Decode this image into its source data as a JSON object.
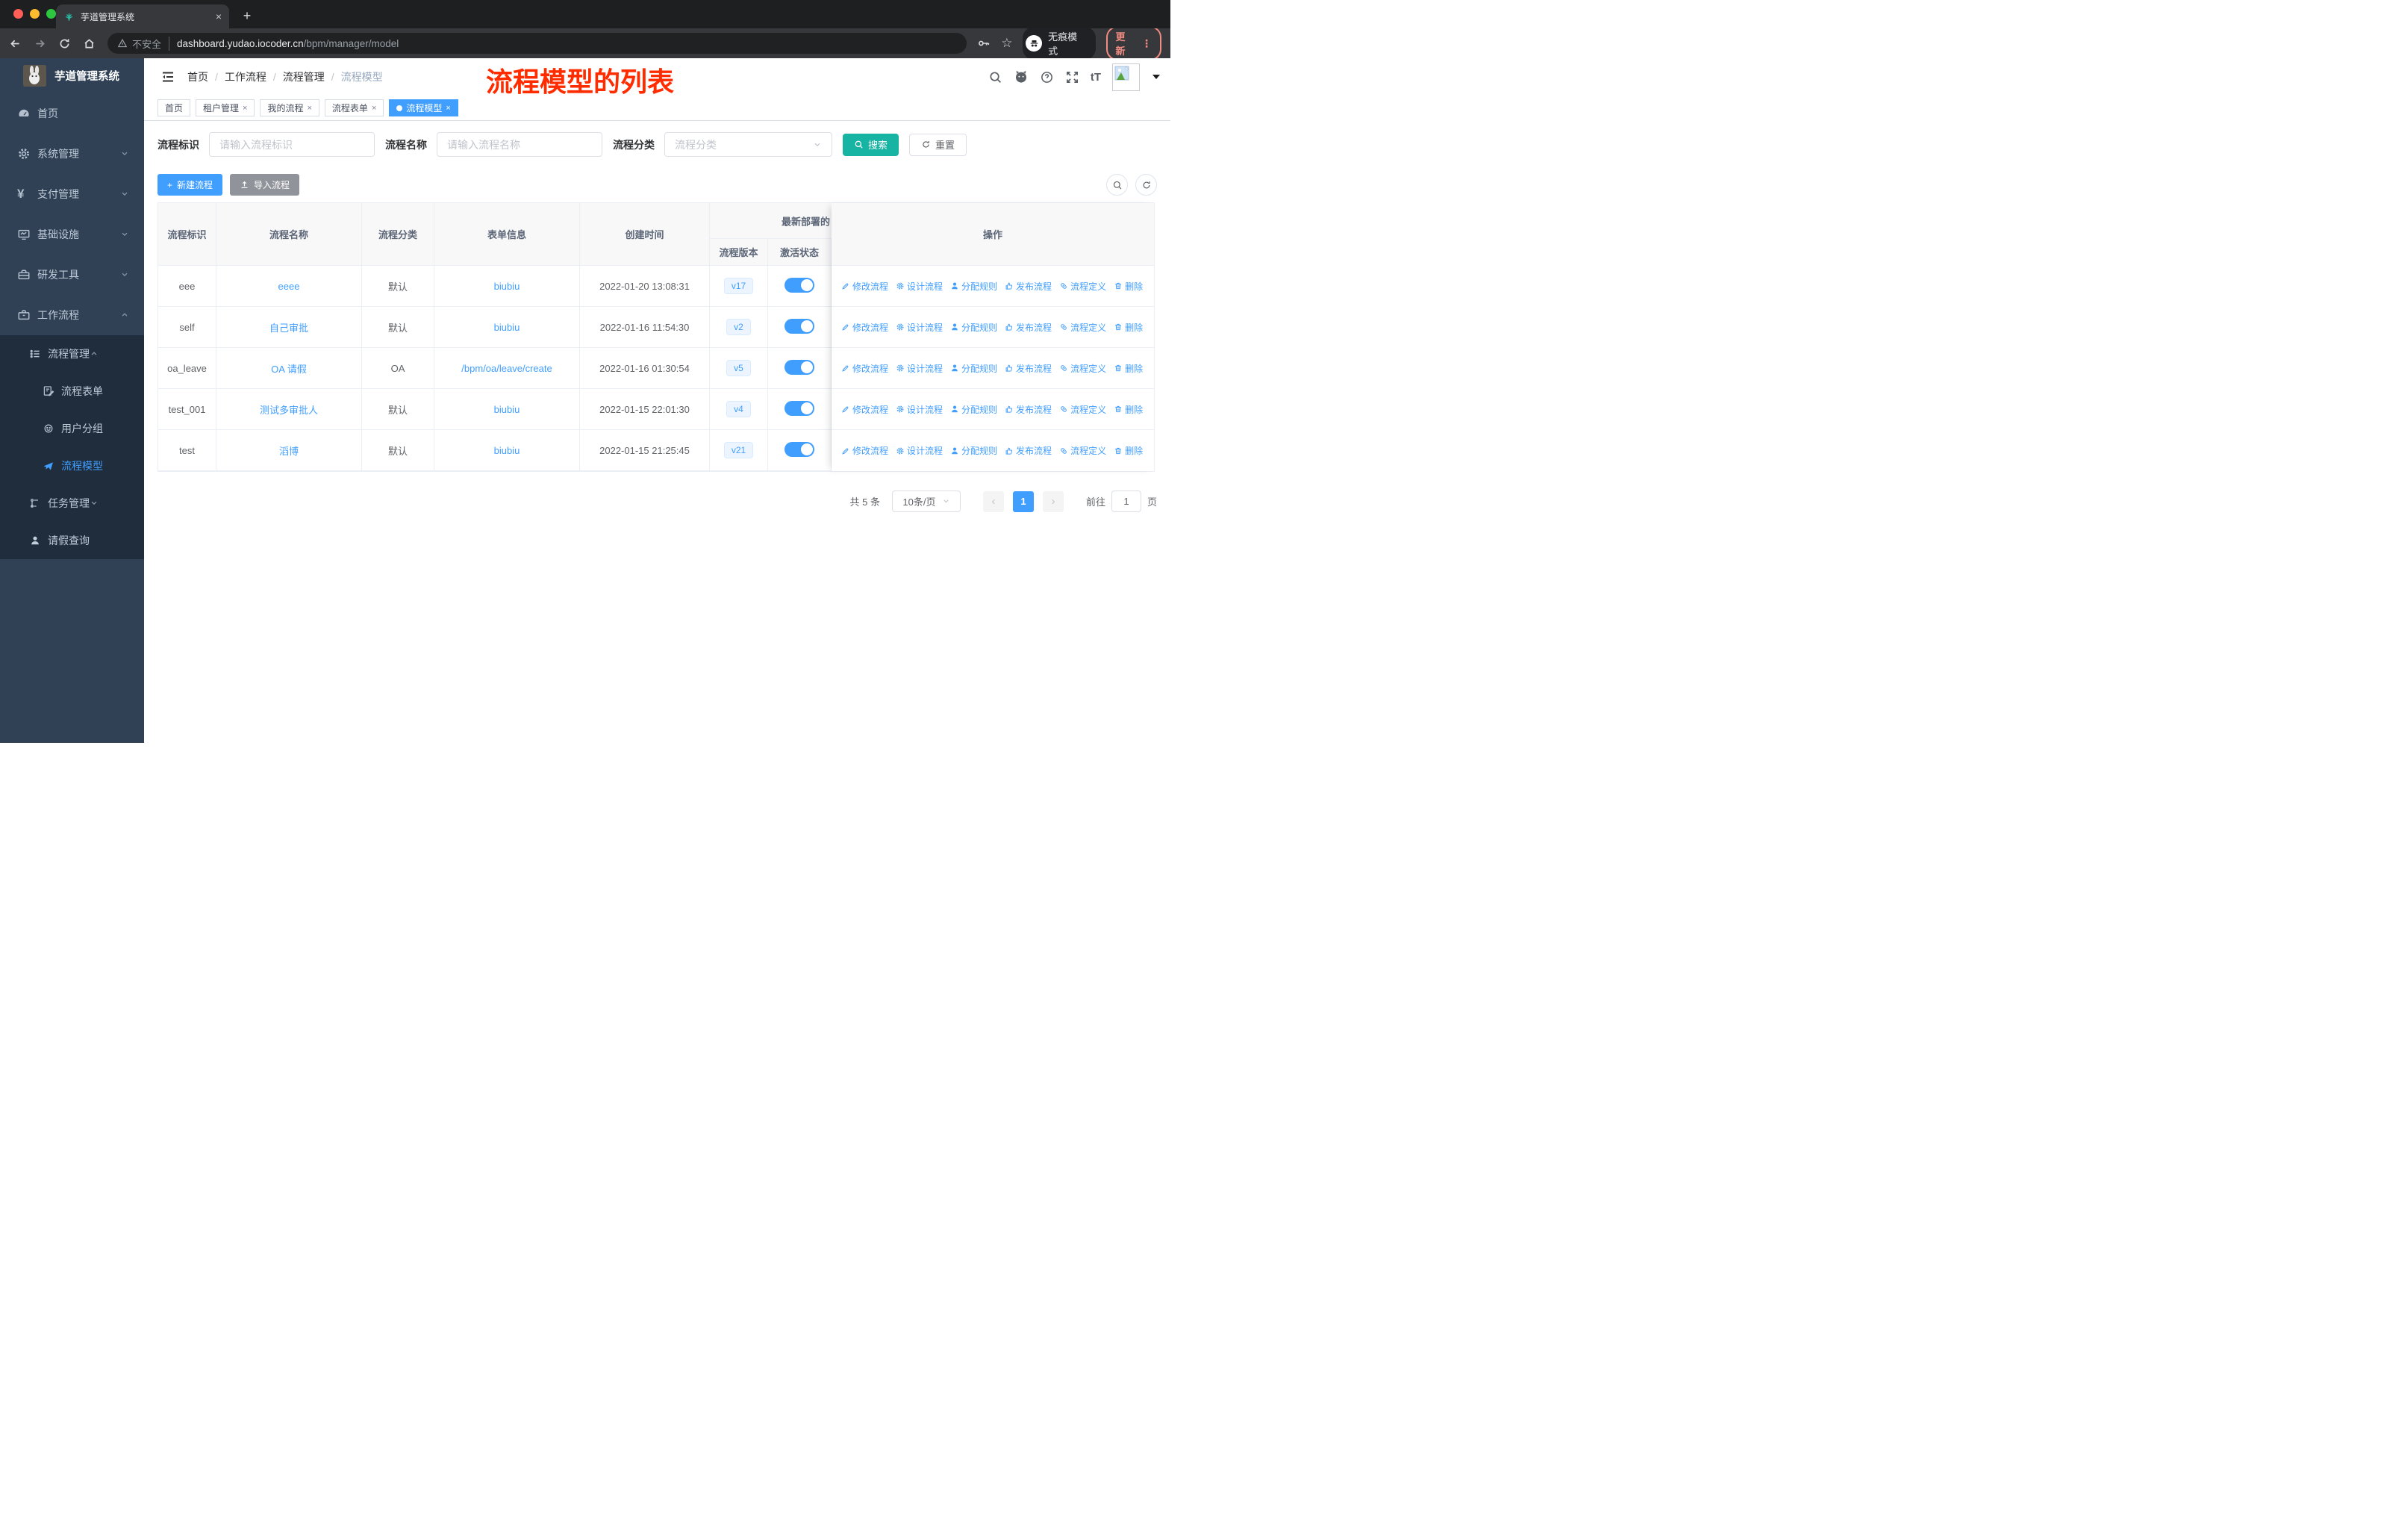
{
  "colors": {
    "accent": "#409eff",
    "teal": "#17b3a3",
    "annotation_red": "#ff2c00",
    "sidebar_bg": "#304156",
    "submenu_bg": "#1f2d3d",
    "update_salmon": "#f28b82"
  },
  "ui": {
    "close_glyph": "×",
    "plus_glyph": "+",
    "separator": "/",
    "fontsize_glyph": "tT"
  },
  "browser": {
    "tab_title": "芋道管理系统",
    "security_label": "不安全",
    "url_host": "dashboard.yudao.iocoder.cn",
    "url_path": "/bpm/manager/model",
    "incognito_label": "无痕模式",
    "update_label": "更新",
    "menu_glyph": "⋮"
  },
  "sidebar": {
    "app_title": "芋道管理系统",
    "items": [
      {
        "label": "首页"
      },
      {
        "label": "系统管理"
      },
      {
        "label": "支付管理"
      },
      {
        "label": "基础设施"
      },
      {
        "label": "研发工具"
      },
      {
        "label": "工作流程"
      }
    ],
    "submenu": [
      {
        "label": "流程管理"
      },
      {
        "label": "流程表单"
      },
      {
        "label": "用户分组"
      },
      {
        "label": "流程模型"
      },
      {
        "label": "任务管理"
      },
      {
        "label": "请假查询"
      }
    ],
    "yen_glyph": "¥"
  },
  "header": {
    "breadcrumb": [
      "首页",
      "工作流程",
      "流程管理",
      "流程模型"
    ],
    "annotation": "流程模型的列表"
  },
  "tabs": [
    {
      "label": "首页"
    },
    {
      "label": "租户管理"
    },
    {
      "label": "我的流程"
    },
    {
      "label": "流程表单"
    },
    {
      "label": "流程模型"
    }
  ],
  "filters": {
    "id_label": "流程标识",
    "id_placeholder": "请输入流程标识",
    "name_label": "流程名称",
    "name_placeholder": "请输入流程名称",
    "category_label": "流程分类",
    "category_placeholder": "流程分类",
    "search_label": "搜索",
    "reset_label": "重置"
  },
  "toolbar": {
    "create_label": "新建流程",
    "import_label": "导入流程"
  },
  "table": {
    "headers": {
      "id": "流程标识",
      "name": "流程名称",
      "category": "流程分类",
      "form": "表单信息",
      "created": "创建时间",
      "group": "最新部署的",
      "version": "流程版本",
      "status": "激活状态",
      "actions": "操作"
    },
    "rows": [
      {
        "id": "eee",
        "name": "eeee",
        "category": "默认",
        "form": "biubiu",
        "created": "2022-01-20 13:08:31",
        "version": "v17"
      },
      {
        "id": "self",
        "name": "自己审批",
        "category": "默认",
        "form": "biubiu",
        "created": "2022-01-16 11:54:30",
        "version": "v2"
      },
      {
        "id": "oa_leave",
        "name": "OA 请假",
        "category": "OA",
        "form": "/bpm/oa/leave/create",
        "created": "2022-01-16 01:30:54",
        "version": "v5"
      },
      {
        "id": "test_001",
        "name": "测试多审批人",
        "category": "默认",
        "form": "biubiu",
        "created": "2022-01-15 22:01:30",
        "version": "v4"
      },
      {
        "id": "test",
        "name": "滔博",
        "category": "默认",
        "form": "biubiu",
        "created": "2022-01-15 21:25:45",
        "version": "v21"
      }
    ],
    "actions": [
      "修改流程",
      "设计流程",
      "分配规则",
      "发布流程",
      "流程定义",
      "删除"
    ]
  },
  "pagination": {
    "total": "共 5 条",
    "page_size": "10条/页",
    "prev_glyph": "‹",
    "next_glyph": "›",
    "current_page": "1",
    "goto_label": "前往",
    "goto_value": "1",
    "page_unit": "页"
  }
}
